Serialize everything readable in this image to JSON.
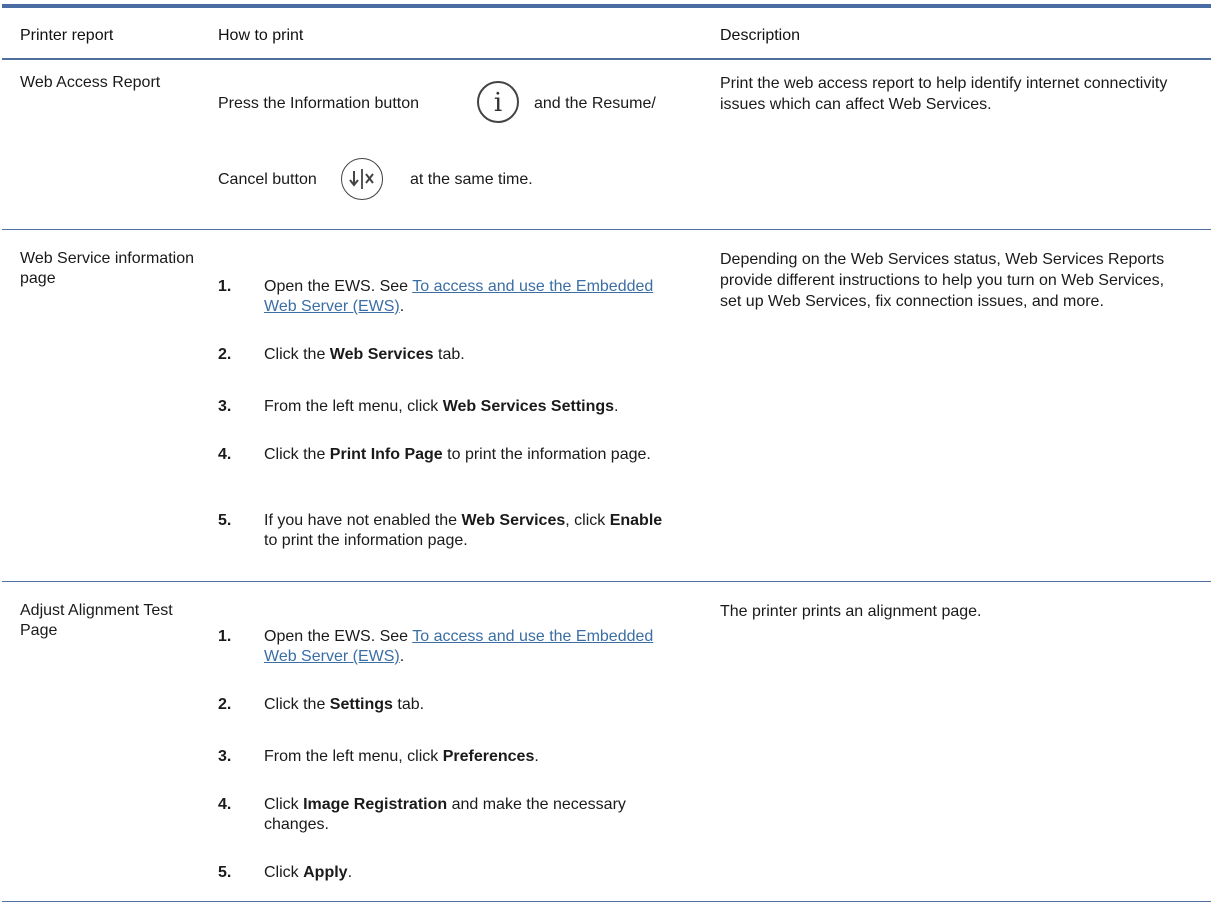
{
  "table": {
    "headers": {
      "printer_report": "Printer report",
      "how_to_print": "How to print",
      "description": "Description"
    },
    "rows": [
      {
        "report": "Web Access Report",
        "how": {
          "line1_pre": "Press the Information button",
          "line1_post": "and the Resume/",
          "line2_pre": "Cancel button",
          "line2_post": "at the same time."
        },
        "description": "Print the web access report to help identify internet connectivity issues which can affect Web Services.",
        "icons": [
          "info-icon",
          "resume-cancel-icon"
        ]
      },
      {
        "report": "Web Service information page",
        "steps": [
          {
            "num": "1.",
            "pre": "Open the EWS. See ",
            "link": "To access and use the Embedded Web Server (EWS)",
            "post": "."
          },
          {
            "num": "2.",
            "pre": "Click the ",
            "bold": "Web Services",
            "post": " tab."
          },
          {
            "num": "3.",
            "pre": "From the left menu, click ",
            "bold": "Web Services Settings",
            "post": "."
          },
          {
            "num": "4.",
            "pre": "Click the ",
            "bold": "Print Info Page",
            "post": " to print the information page."
          },
          {
            "num": "5.",
            "pre": "If you have not enabled the ",
            "bold": "Web Services",
            "mid": ", click ",
            "bold2": "Enable",
            "post": " to print the information page."
          }
        ],
        "description": "Depending on the Web Services status, Web Services Reports provide different instructions to help you turn on Web Services, set up Web Services, fix connection issues, and more."
      },
      {
        "report": "Adjust Alignment Test Page",
        "steps": [
          {
            "num": "1.",
            "pre": "Open the EWS. See ",
            "link": "To access and use the Embedded Web Server (EWS)",
            "post": "."
          },
          {
            "num": "2.",
            "pre": "Click the ",
            "bold": "Settings",
            "post": " tab."
          },
          {
            "num": "3.",
            "pre": "From the left menu, click ",
            "bold": "Preferences",
            "post": "."
          },
          {
            "num": "4.",
            "pre": "Click ",
            "bold": "Image Registration",
            "post": " and make the necessary changes."
          },
          {
            "num": "5.",
            "pre": "Click ",
            "bold": "Apply",
            "post": "."
          }
        ],
        "description": "The printer prints an alignment page."
      }
    ]
  },
  "colors": {
    "rule": "#4a6da3",
    "link": "#3a6ea5",
    "text": "#1a1a1a"
  }
}
